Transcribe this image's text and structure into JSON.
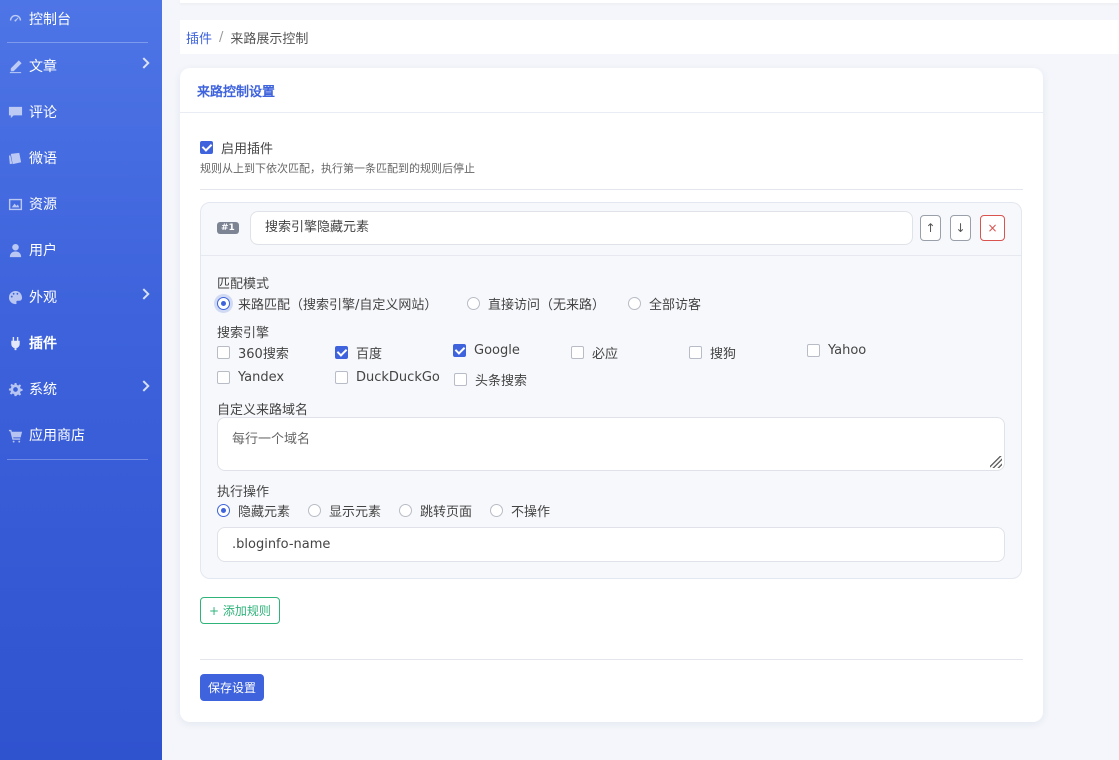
{
  "sidebar": {
    "items": [
      {
        "label": "控制台",
        "icon": "dashboard-icon",
        "arrow": false
      },
      {
        "label": "文章",
        "icon": "pencil-icon",
        "arrow": true
      },
      {
        "label": "评论",
        "icon": "comment-icon",
        "arrow": false
      },
      {
        "label": "微语",
        "icon": "cards-icon",
        "arrow": false
      },
      {
        "label": "资源",
        "icon": "image-icon",
        "arrow": false
      },
      {
        "label": "用户",
        "icon": "user-icon",
        "arrow": false
      },
      {
        "label": "外观",
        "icon": "palette-icon",
        "arrow": true
      },
      {
        "label": "插件",
        "icon": "plug-icon",
        "arrow": false,
        "active": true
      },
      {
        "label": "系统",
        "icon": "gear-icon",
        "arrow": true
      },
      {
        "label": "应用商店",
        "icon": "cart-icon",
        "arrow": false
      }
    ]
  },
  "breadcrumb": {
    "parent": "插件",
    "separator": "/",
    "current": "来路展示控制"
  },
  "card": {
    "title": "来路控制设置",
    "enable_label": "启用插件",
    "enable_checked": true,
    "hint": "规则从上到下依次匹配，执行第一条匹配到的规则后停止",
    "rule": {
      "number": "#1",
      "name": "搜索引擎隐藏元素",
      "up_label": "↑",
      "down_label": "↓",
      "delete_label": "×",
      "match_mode_label": "匹配模式",
      "match_modes": [
        "来路匹配（搜索引擎/自定义网站）",
        "直接访问（无来路）",
        "全部访客"
      ],
      "match_mode_selected": 0,
      "engines_label": "搜索引擎",
      "engines": [
        {
          "label": "360搜索",
          "checked": false
        },
        {
          "label": "百度",
          "checked": true
        },
        {
          "label": "Google",
          "checked": true
        },
        {
          "label": "必应",
          "checked": false
        },
        {
          "label": "搜狗",
          "checked": false
        },
        {
          "label": "Yahoo",
          "checked": false
        },
        {
          "label": "Yandex",
          "checked": false
        },
        {
          "label": "DuckDuckGo",
          "checked": false
        },
        {
          "label": "头条搜索",
          "checked": false
        }
      ],
      "custom_domain_label": "自定义来路域名",
      "custom_domain_placeholder": "每行一个域名",
      "action_label": "执行操作",
      "actions": [
        "隐藏元素",
        "显示元素",
        "跳转页面",
        "不操作"
      ],
      "action_selected": 0,
      "selector_value": ".bloginfo-name"
    },
    "add_rule_label": "+ 添加规则",
    "save_label": "保存设置"
  },
  "colors": {
    "accent": "#3e63dc",
    "success": "#2fb37a",
    "danger": "#d9534f"
  }
}
